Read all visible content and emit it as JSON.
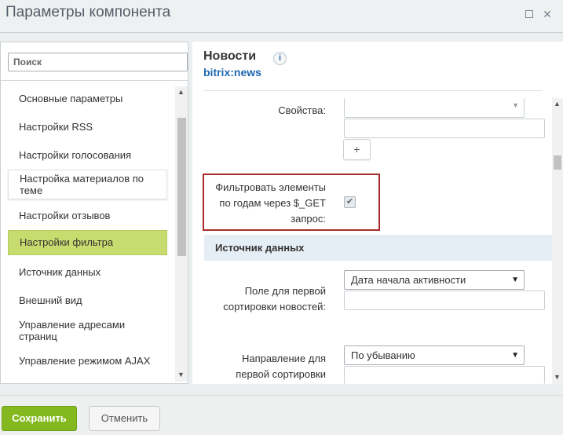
{
  "window": {
    "title": "Параметры компонента"
  },
  "sidebar": {
    "search_placeholder": "Поиск",
    "items": [
      {
        "label": "Основные параметры"
      },
      {
        "label": "Настройки RSS"
      },
      {
        "label": "Настройки голосования"
      },
      {
        "label": "Настройка материалов по теме"
      },
      {
        "label": "Настройки отзывов"
      },
      {
        "label": "Настройки фильтра"
      },
      {
        "label": "Источник данных"
      },
      {
        "label": "Внешний вид"
      },
      {
        "label": "Управление адресами страниц"
      },
      {
        "label": "Управление режимом AJAX"
      }
    ],
    "active_item": "Настройки фильтра"
  },
  "main": {
    "component_title": "Новости",
    "component_code": "bitrix:news",
    "info_icon": "i",
    "properties_label": "Свойства:",
    "plus_button": "+",
    "filter_label": "Фильтровать элементы по годам через $_GET запрос:",
    "filter_checked": true,
    "section_title": "Источник данных",
    "sort_field_label": "Поле для первой сортировки новостей:",
    "sort_field_value": "Дата начала активности",
    "sort_order_label": "Направление для первой сортировки",
    "sort_order_value": "По убыванию"
  },
  "footer": {
    "save_label": "Сохранить",
    "cancel_label": "Отменить"
  },
  "colors": {
    "accent_green": "#83b81f",
    "active_item": "#c8db6e",
    "highlight_border": "#a92b2b",
    "link_blue": "#2067b0"
  }
}
